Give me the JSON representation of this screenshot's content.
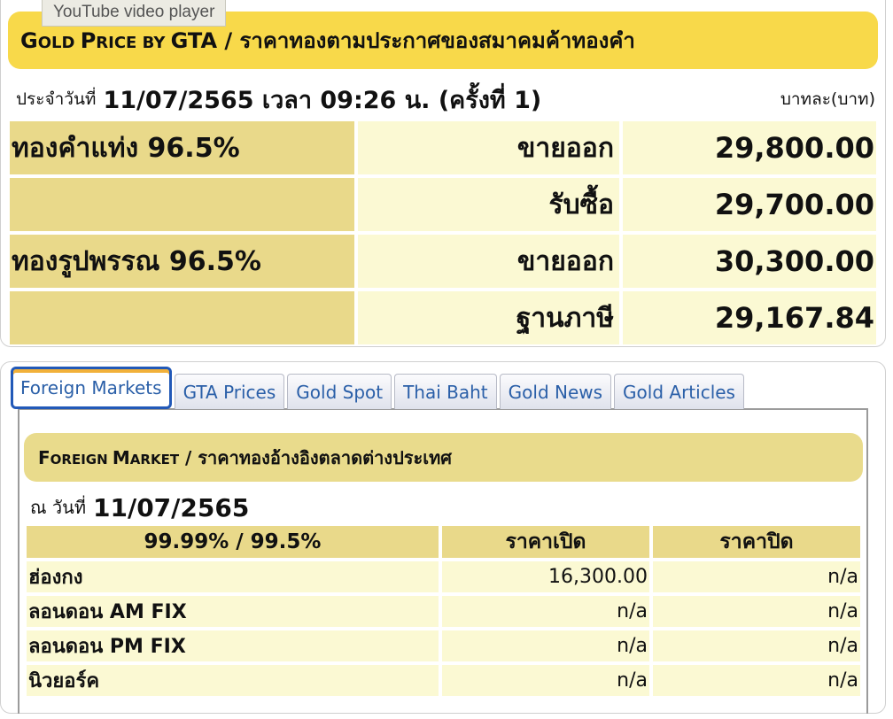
{
  "tooltip": "YouTube video player",
  "gta": {
    "title_en_words": [
      {
        "big": "G",
        "small": "OLD "
      },
      {
        "big": "P",
        "small": "RICE BY "
      },
      {
        "big": "GTA",
        "small": ""
      }
    ],
    "title_sep": " / ",
    "title_th": "ราคาทองตามประกาศของสมาคมค้าทองคำ",
    "date_label": "ประจำวันที่",
    "date_value": "11/07/2565 เวลา 09:26 น. (ครั้งที่ 1)",
    "unit_label": "บาทละ(บาท)",
    "rows": [
      {
        "category": "ทองคำแท่ง 96.5%",
        "type": "ขายออก",
        "price": "29,800.00"
      },
      {
        "category": "",
        "type": "รับซื้อ",
        "price": "29,700.00"
      },
      {
        "category": "ทองรูปพรรณ 96.5%",
        "type": "ขายออก",
        "price": "30,300.00"
      },
      {
        "category": "",
        "type": "ฐานภาษี",
        "price": "29,167.84"
      }
    ]
  },
  "tabs": [
    {
      "label": "Foreign Markets",
      "active": true
    },
    {
      "label": "GTA Prices",
      "active": false
    },
    {
      "label": "Gold Spot",
      "active": false
    },
    {
      "label": "Thai Baht",
      "active": false
    },
    {
      "label": "Gold News",
      "active": false
    },
    {
      "label": "Gold Articles",
      "active": false
    }
  ],
  "foreign": {
    "title_en_words": [
      {
        "big": "F",
        "small": "OREIGN "
      },
      {
        "big": "M",
        "small": "ARKET"
      }
    ],
    "title_sep": " / ",
    "title_th": "ราคาทองอ้างอิงตลาดต่างประเทศ",
    "date_label": "ณ วันที่",
    "date_value": "11/07/2565",
    "headers": [
      "99.99% / 99.5%",
      "ราคาเปิด",
      "ราคาปิด"
    ],
    "rows": [
      {
        "market": "ฮ่องกง",
        "open": "16,300.00",
        "close": "n/a"
      },
      {
        "market": "ลอนดอน AM FIX",
        "open": "n/a",
        "close": "n/a"
      },
      {
        "market": "ลอนดอน PM FIX",
        "open": "n/a",
        "close": "n/a"
      },
      {
        "market": "นิวยอร์ค",
        "open": "n/a",
        "close": "n/a"
      }
    ]
  },
  "colors": {
    "title_yellow": "#f8d94a",
    "category_gold": "#e9d98a",
    "cell_cream": "#fbf9d3",
    "tab_blue": "#2259b8",
    "tab_text": "#2a5fa8"
  }
}
